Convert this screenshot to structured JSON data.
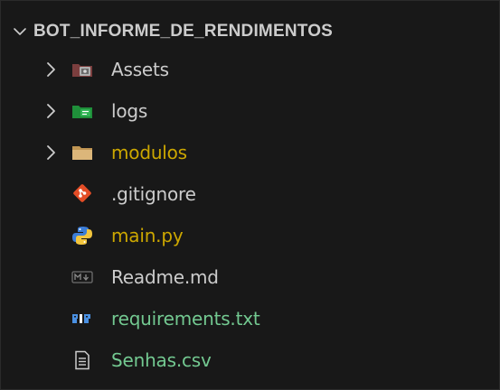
{
  "explorer": {
    "title": "BOT_INFORME_DE_RENDIMENTOS",
    "items": [
      {
        "label": "Assets",
        "kind": "folder",
        "icon": "assets-folder-icon",
        "color": "#cccccc"
      },
      {
        "label": "logs",
        "kind": "folder",
        "icon": "logs-folder-icon",
        "color": "#cccccc"
      },
      {
        "label": "modulos",
        "kind": "folder",
        "icon": "folder-icon",
        "color": "#cca700"
      },
      {
        "label": ".gitignore",
        "kind": "file",
        "icon": "git-icon",
        "color": "#cccccc"
      },
      {
        "label": "main.py",
        "kind": "file",
        "icon": "python-icon",
        "color": "#cca700"
      },
      {
        "label": "Readme.md",
        "kind": "file",
        "icon": "markdown-icon",
        "color": "#cccccc"
      },
      {
        "label": "requirements.txt",
        "kind": "file",
        "icon": "pip-icon",
        "color": "#73c991"
      },
      {
        "label": "Senhas.csv",
        "kind": "file",
        "icon": "csv-icon",
        "color": "#73c991"
      }
    ]
  }
}
